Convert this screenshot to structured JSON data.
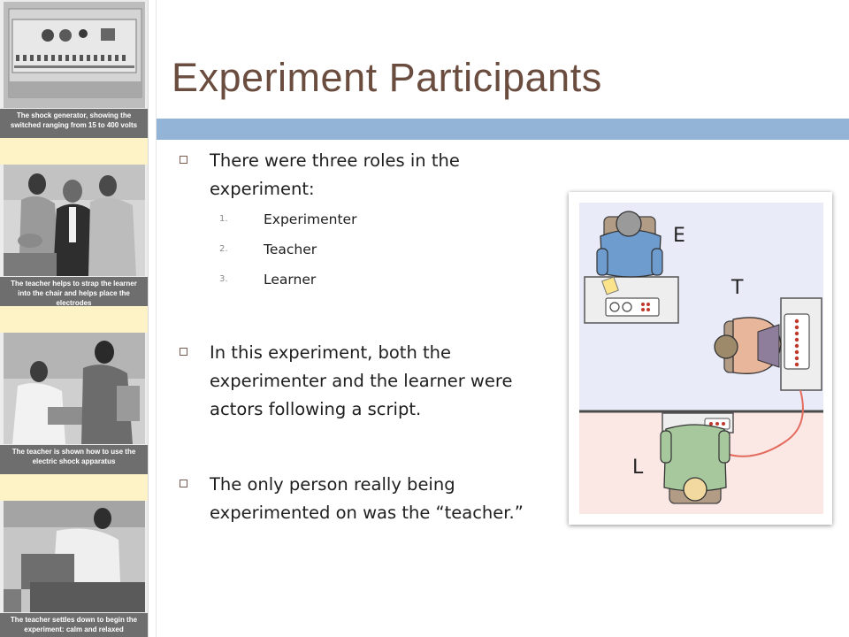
{
  "slide": {
    "title": "Experiment Participants",
    "accent_color": "#93b4d6",
    "title_color": "#6b4d40"
  },
  "sidebar": {
    "captions": [
      "The shock generator, showing the\nswitched ranging from 15 to 400 volts",
      "The teacher helps to strap the learner\ninto the chair and helps place the electrodes",
      "The teacher is shown how to use the\nelectric shock apparatus",
      "The teacher settles down to begin the\nexperiment: calm and relaxed"
    ]
  },
  "bullets": [
    {
      "text": "There were three roles in the experiment:",
      "subitems": [
        {
          "num": "1.",
          "label": "Experimenter"
        },
        {
          "num": "2.",
          "label": "Teacher"
        },
        {
          "num": "3.",
          "label": "Learner"
        }
      ]
    },
    {
      "text": "In this experiment, both the experimenter and the learner were actors following a script."
    },
    {
      "text": "The only person really being experimented on was the “teacher.”"
    }
  ],
  "diagram": {
    "labels": {
      "experimenter": "E",
      "teacher": "T",
      "learner": "L"
    },
    "colors": {
      "upper_room": "#e9ebf8",
      "lower_room": "#fbe7e4",
      "wire": "#e36b5d"
    }
  }
}
